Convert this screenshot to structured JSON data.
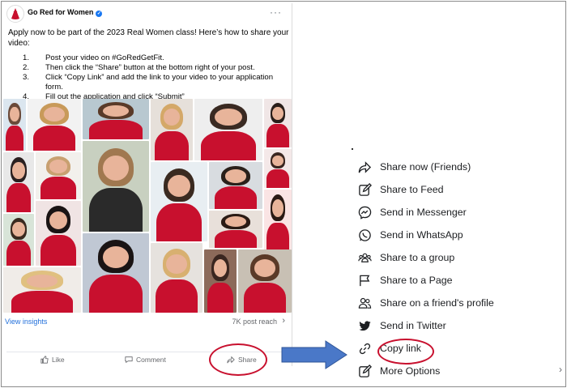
{
  "post": {
    "page_name": "Go Red for Women",
    "more_icon": "more-horizontal-icon",
    "intro": "Apply now to be part of the 2023 Real Women class! Here’s how to share your video:",
    "steps": [
      {
        "num": "1.",
        "text": "Post your video on #GoRedGetFit."
      },
      {
        "num": "2.",
        "text": "Then click the “Share” button at the bottom right of your post."
      },
      {
        "num": "3.",
        "text": "Click “Copy Link” and add the link to your video to your application form."
      },
      {
        "num": "4.",
        "text": "Fill out the application and click “Submit”"
      }
    ],
    "view_insights": "View insights",
    "post_reach": "7K post reach",
    "actions": {
      "like": "Like",
      "comment": "Comment",
      "share": "Share"
    }
  },
  "share_menu": {
    "items": [
      {
        "label": "Share now (Friends)",
        "icon": "share-arrow-icon"
      },
      {
        "label": "Share to Feed",
        "icon": "edit-icon"
      },
      {
        "label": "Send in Messenger",
        "icon": "messenger-icon"
      },
      {
        "label": "Send in WhatsApp",
        "icon": "whatsapp-icon"
      },
      {
        "label": "Share to a group",
        "icon": "group-icon"
      },
      {
        "label": "Share to a Page",
        "icon": "flag-icon"
      },
      {
        "label": "Share on a friend's profile",
        "icon": "friend-profile-icon"
      },
      {
        "label": "Send in Twitter",
        "icon": "twitter-icon"
      },
      {
        "label": "Copy link",
        "icon": "link-icon"
      },
      {
        "label": "More Options",
        "icon": "edit-icon"
      }
    ]
  },
  "colors": {
    "accent_red": "#c8102e",
    "link_blue": "#216fdb",
    "arrow_blue": "#4a78c8"
  }
}
